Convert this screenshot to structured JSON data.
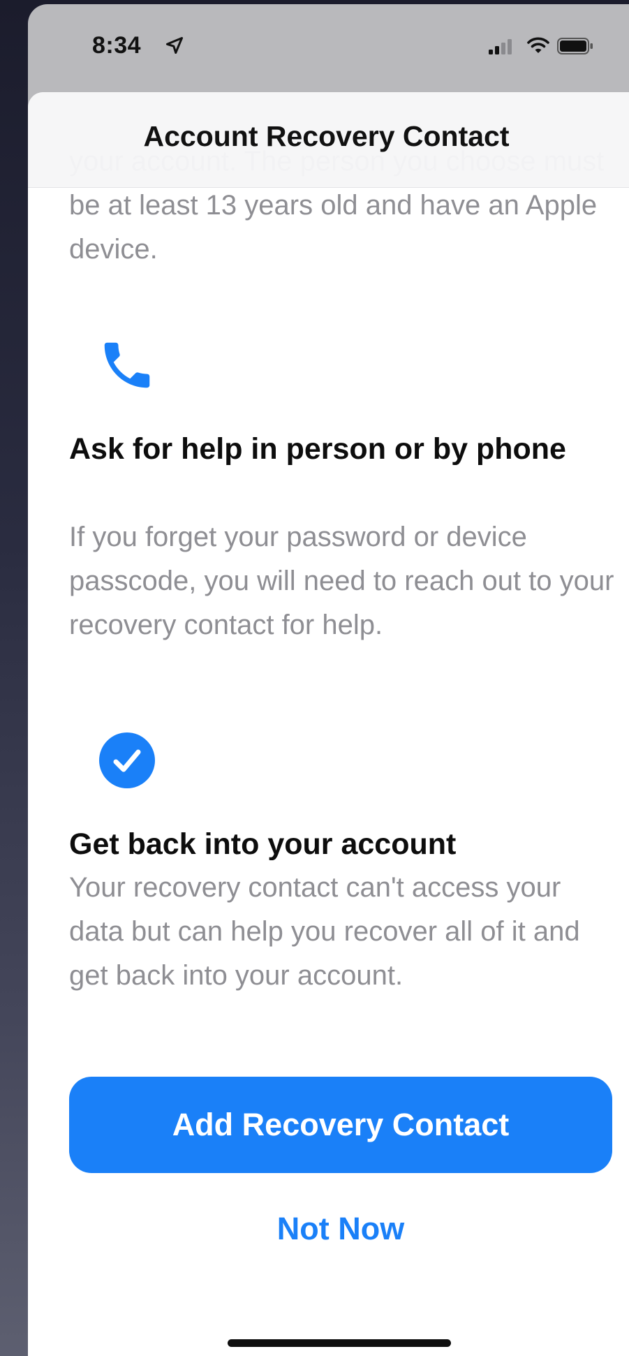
{
  "status_bar": {
    "time": "8:34",
    "location_icon": "location-arrow-icon",
    "signal_icon": "cellular-signal-icon",
    "wifi_icon": "wifi-icon",
    "battery_icon": "battery-icon"
  },
  "sheet": {
    "title": "Account Recovery Contact",
    "intro_text": "your account. The person you choose must be at least 13 years old and have an Apple device.",
    "features": [
      {
        "icon": "phone-icon",
        "heading": "Ask for help in person or by phone",
        "body": "If you forget your password or device passcode, you will need to reach out to your recovery contact for help."
      },
      {
        "icon": "checkmark-circle-icon",
        "heading": "Get back into your account",
        "body": "Your recovery contact can't access your data but can help you recover all of it and get back into your account."
      }
    ],
    "primary_button_label": "Add Recovery Contact",
    "secondary_button_label": "Not Now"
  },
  "colors": {
    "accent": "#1a80f8",
    "body_text": "#8e8e93",
    "heading_text": "#0d0d0d",
    "status_bar_background": "#b9b9bc",
    "sheet_background": "#ffffff",
    "header_background": "#f6f6f7"
  }
}
